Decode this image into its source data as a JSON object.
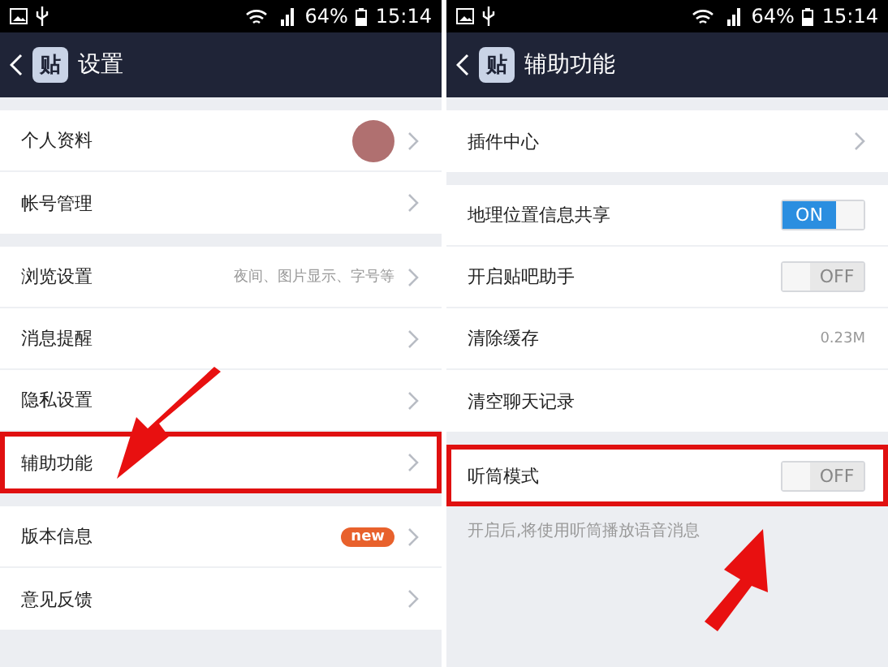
{
  "panels": [
    {
      "status_bar": {
        "battery": "64%",
        "time": "15:14"
      },
      "header": {
        "logo": "贴",
        "title": "设置"
      },
      "sections": [
        {
          "rows": [
            {
              "kind": "avatar",
              "label": "个人资料",
              "highlighted": false
            },
            {
              "kind": "link",
              "label": "帐号管理",
              "highlighted": false
            }
          ]
        },
        {
          "rows": [
            {
              "kind": "value",
              "label": "浏览设置",
              "value": "夜间、图片显示、字号等",
              "highlighted": false
            },
            {
              "kind": "link",
              "label": "消息提醒",
              "highlighted": false
            },
            {
              "kind": "link",
              "label": "隐私设置",
              "highlighted": false
            },
            {
              "kind": "link",
              "label": "辅助功能",
              "highlighted": true
            }
          ]
        },
        {
          "rows": [
            {
              "kind": "badge",
              "label": "版本信息",
              "badge": "new",
              "highlighted": false
            },
            {
              "kind": "link",
              "label": "意见反馈",
              "highlighted": false
            }
          ]
        }
      ]
    },
    {
      "status_bar": {
        "battery": "64%",
        "time": "15:14"
      },
      "header": {
        "logo": "贴",
        "title": "辅助功能"
      },
      "sections": [
        {
          "rows": [
            {
              "kind": "link",
              "label": "插件中心",
              "highlighted": false
            }
          ]
        },
        {
          "rows": [
            {
              "kind": "toggle",
              "label": "地理位置信息共享",
              "on": true,
              "on_text": "ON",
              "highlighted": false
            },
            {
              "kind": "toggle",
              "label": "开启贴吧助手",
              "on": false,
              "off_text": "OFF",
              "highlighted": false
            },
            {
              "kind": "info",
              "label": "清除缓存",
              "value": "0.23M",
              "highlighted": false
            },
            {
              "kind": "plain",
              "label": "清空聊天记录",
              "highlighted": false
            }
          ]
        },
        {
          "rows": [
            {
              "kind": "toggle",
              "label": "听筒模式",
              "on": false,
              "off_text": "OFF",
              "highlighted": true
            }
          ],
          "note": "开启后,将使用听筒播放语音消息"
        }
      ]
    }
  ]
}
